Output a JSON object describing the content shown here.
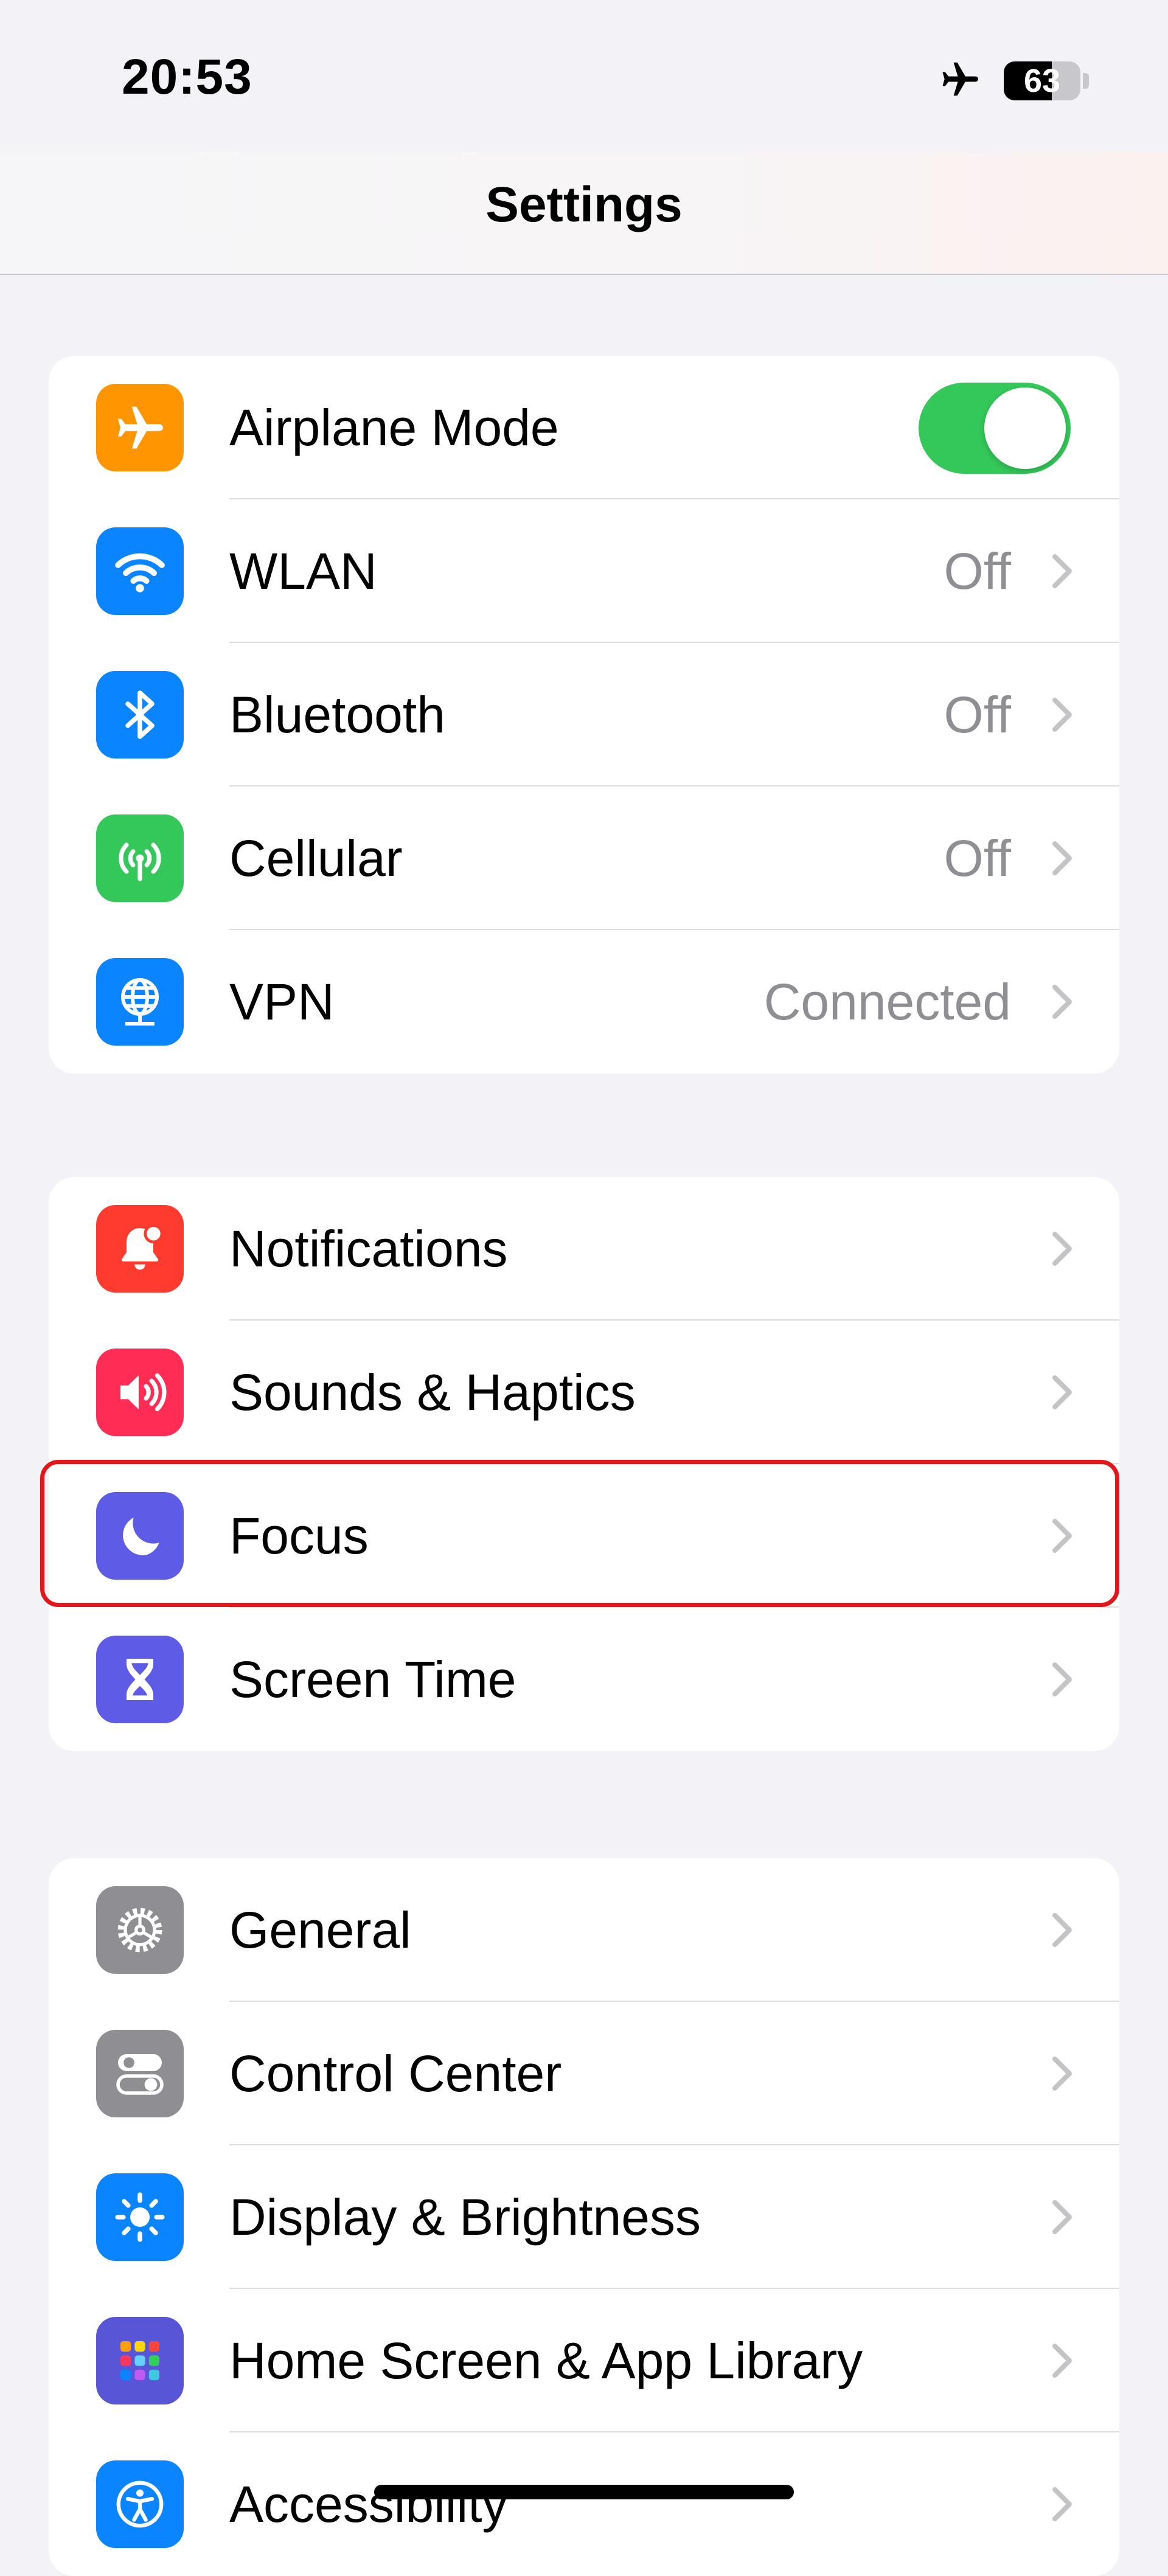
{
  "status_bar": {
    "time": "20:53",
    "battery_percent": 63,
    "battery_label": "63",
    "airplane_icon": "airplane-icon"
  },
  "nav": {
    "title": "Settings"
  },
  "groups": [
    {
      "rows": [
        {
          "label": "Airplane Mode",
          "icon": "airplane-icon",
          "icon_bg": "#ff9500",
          "toggle": true,
          "toggle_on": true,
          "toggle_color": "#34c759"
        },
        {
          "label": "WLAN",
          "value": "Off",
          "icon": "wifi-icon",
          "icon_bg": "#0a84ff"
        },
        {
          "label": "Bluetooth",
          "value": "Off",
          "icon": "bluetooth-icon",
          "icon_bg": "#0a84ff"
        },
        {
          "label": "Cellular",
          "value": "Off",
          "icon": "antenna-icon",
          "icon_bg": "#34c759"
        },
        {
          "label": "VPN",
          "value": "Connected",
          "icon": "globe-icon",
          "icon_bg": "#0a84ff"
        }
      ]
    },
    {
      "rows": [
        {
          "label": "Notifications",
          "icon": "bell-icon",
          "icon_bg": "#ff3b30"
        },
        {
          "label": "Sounds & Haptics",
          "icon": "speaker-icon",
          "icon_bg": "#ff2d55"
        },
        {
          "label": "Focus",
          "icon": "moon-icon",
          "icon_bg": "#5e5ce6",
          "highlighted": true
        },
        {
          "label": "Screen Time",
          "icon": "hourglass-icon",
          "icon_bg": "#5e5ce6"
        }
      ]
    },
    {
      "rows": [
        {
          "label": "General",
          "icon": "gear-icon",
          "icon_bg": "#8e8e93"
        },
        {
          "label": "Control Center",
          "icon": "switches-icon",
          "icon_bg": "#8e8e93"
        },
        {
          "label": "Display & Brightness",
          "icon": "sun-icon",
          "icon_bg": "#0a84ff"
        },
        {
          "label": "Home Screen & App Library",
          "icon": "app-grid-icon",
          "icon_bg": "#5856d6"
        },
        {
          "label": "Accessibility",
          "icon": "accessibility-icon",
          "icon_bg": "#0a84ff"
        }
      ]
    }
  ],
  "colors": {
    "background": "#f2f2f7",
    "highlight_border": "#e3171b",
    "secondary_text": "#8e8e93"
  }
}
